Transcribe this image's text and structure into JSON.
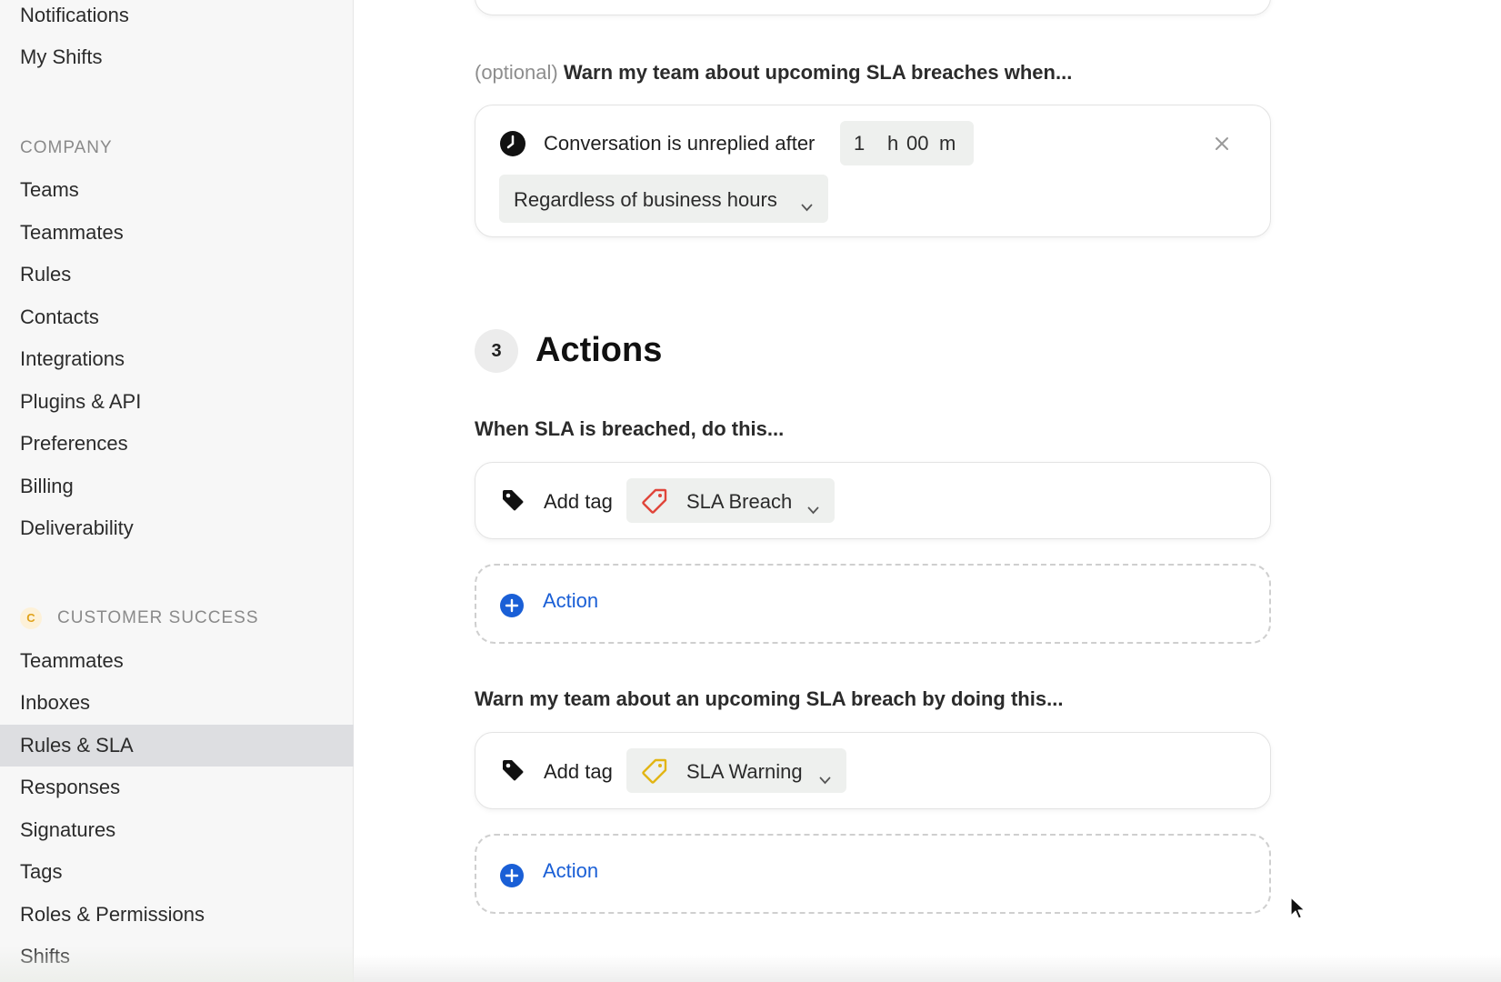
{
  "sidebar": {
    "top_items": [
      {
        "label": "Notifications"
      },
      {
        "label": "My Shifts"
      }
    ],
    "company_label": "COMPANY",
    "company_items": [
      {
        "label": "Teams"
      },
      {
        "label": "Teammates"
      },
      {
        "label": "Rules"
      },
      {
        "label": "Contacts"
      },
      {
        "label": "Integrations"
      },
      {
        "label": "Plugins & API"
      },
      {
        "label": "Preferences"
      },
      {
        "label": "Billing"
      },
      {
        "label": "Deliverability"
      }
    ],
    "workspace_badge": "C",
    "workspace_label": "CUSTOMER SUCCESS",
    "workspace_items": [
      {
        "label": "Teammates"
      },
      {
        "label": "Inboxes"
      },
      {
        "label": "Rules & SLA",
        "active": true
      },
      {
        "label": "Responses"
      },
      {
        "label": "Signatures"
      },
      {
        "label": "Tags"
      },
      {
        "label": "Roles & Permissions"
      },
      {
        "label": "Shifts"
      }
    ]
  },
  "warning": {
    "optional_label": "(optional)",
    "prompt": "Warn my team about upcoming SLA breaches when...",
    "condition": {
      "text": "Conversation is unreplied after",
      "hours_value": "1",
      "hours_unit": "h",
      "minutes_value": "00",
      "minutes_unit": "m",
      "business_hours_option": "Regardless of business hours"
    }
  },
  "actions": {
    "step_number": "3",
    "title": "Actions",
    "breach_prompt": "When SLA is breached, do this...",
    "breach_action": {
      "label": "Add tag",
      "tag": "SLA Breach",
      "tag_color": "#e0453a"
    },
    "add_action_label": "Action",
    "warn_prompt": "Warn my team about an upcoming SLA breach by doing this...",
    "warn_action": {
      "label": "Add tag",
      "tag": "SLA Warning",
      "tag_color": "#e2b514"
    }
  },
  "colors": {
    "accent": "#1a5fd6",
    "active_nav": "#dddee1"
  }
}
